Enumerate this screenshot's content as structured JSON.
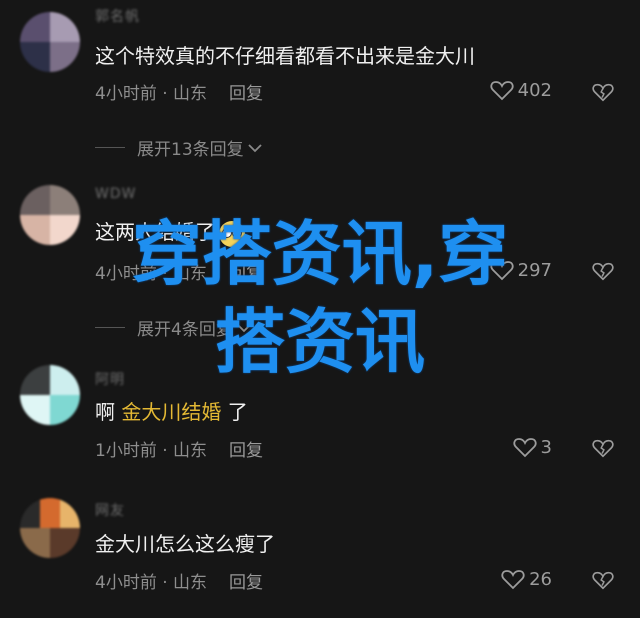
{
  "comments": [
    {
      "username": "郭名帆",
      "content": "这个特效真的不仔细看都看不出来是金大川",
      "time_location": "4小时前 · 山东",
      "reply_label": "回复",
      "likes": "402",
      "expand_label": "展开13条回复"
    },
    {
      "username": "WDW",
      "content": "这两人结婚了",
      "time_location": "4小时前 · 山东",
      "reply_label": "回复",
      "likes": "297",
      "expand_label": "展开4条回复"
    },
    {
      "username": "阿明",
      "content_prefix": "啊",
      "content_mention": "金大川结婚",
      "content_suffix": "了",
      "time_location": "1小时前 · 山东",
      "reply_label": "回复",
      "likes": "3"
    },
    {
      "username": "网友",
      "content": "金大川怎么这么瘦了",
      "time_location": "4小时前 · 山东",
      "reply_label": "回复",
      "likes": "26"
    }
  ],
  "overlay": {
    "line1": "穿搭资讯,穿",
    "line2": "搭资讯"
  },
  "colors": {
    "background": "#161616",
    "overlay_text": "#1e8ff0",
    "mention": "#e4b934"
  },
  "icons": {
    "like": "heart-outline-icon",
    "dislike": "broken-heart-icon",
    "expand": "chevron-down-icon"
  }
}
